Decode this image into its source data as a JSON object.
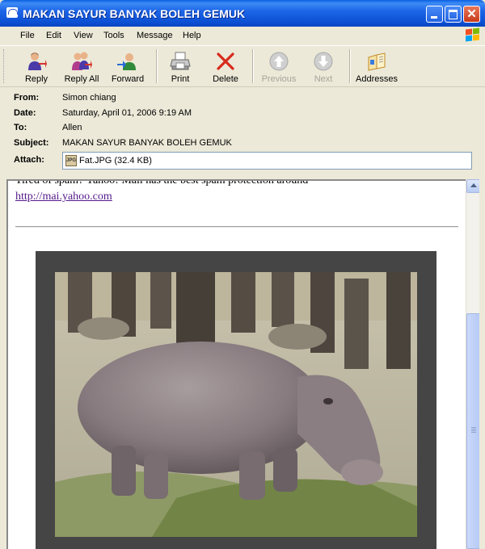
{
  "window": {
    "title": "MAKAN SAYUR BANYAK BOLEH GEMUK",
    "close_glyph": "✕"
  },
  "menu": [
    "File",
    "Edit",
    "View",
    "Tools",
    "Message",
    "Help"
  ],
  "toolbar": {
    "reply": "Reply",
    "reply_all": "Reply All",
    "forward": "Forward",
    "print": "Print",
    "delete": "Delete",
    "previous": "Previous",
    "next": "Next",
    "addresses": "Addresses"
  },
  "header": {
    "from_label": "From:",
    "from": "Simon chiang",
    "date_label": "Date:",
    "date": "Saturday, April 01, 2006 9:19 AM",
    "to_label": "To:",
    "to": "Allen",
    "subject_label": "Subject:",
    "subject": "MAKAN SAYUR BANYAK BOLEH GEMUK",
    "attach_label": "Attach:",
    "attachment": "Fat.JPG (32.4 KB)",
    "attachment_icon_text": "JPG"
  },
  "body": {
    "cut_text": "Tired of spam? Yahoo! Mail has the best spam protection around",
    "link": "http://mai.yahoo.com"
  },
  "colors": {
    "titlebar": "#0B4FD3",
    "link": "#551A8B",
    "delete_red": "#D72A1C",
    "frame": "#454545"
  },
  "icons": {
    "reply": "reply-icon",
    "reply_all": "reply-all-icon",
    "forward": "forward-icon",
    "print": "printer-icon",
    "delete": "delete-x-icon",
    "previous": "up-arrow-icon",
    "next": "down-arrow-icon",
    "addresses": "address-book-icon"
  }
}
